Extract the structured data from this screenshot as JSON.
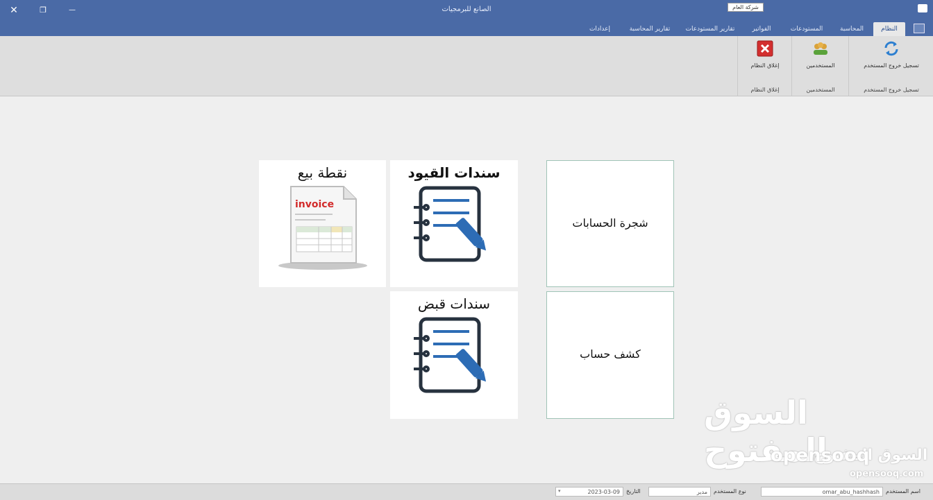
{
  "window": {
    "title": "الصانع للبرمجيات",
    "company": "شركة العام",
    "close_glyph": "✕",
    "restore_glyph": "❐",
    "minimize_glyph": "—"
  },
  "tabs": [
    {
      "label": "النظام",
      "active": true
    },
    {
      "label": "المحاسبة"
    },
    {
      "label": "المستودعات"
    },
    {
      "label": "الفواتير"
    },
    {
      "label": "تقارير المستودعات"
    },
    {
      "label": "تقارير المحاسبة"
    },
    {
      "label": "إعدادات"
    }
  ],
  "ribbon": {
    "logout": {
      "label": "تسجيل خروج المستخدم",
      "group": "تسجيل خروج المستخدم",
      "icon": "refresh-icon"
    },
    "users": {
      "label": "المستخدمين",
      "group": "المستخدمين",
      "icon": "users-icon"
    },
    "close_system": {
      "label": "إغلاق النظام",
      "group": "إغلاق النظام",
      "icon": "close-red-icon"
    }
  },
  "tiles": {
    "chart_of_accounts": "شجرة الحسابات",
    "account_statement": "كشف حساب",
    "journal_vouchers": "سندات القيود",
    "receipt_vouchers": "سندات قبض",
    "point_of_sale": "نقطة بيع",
    "invoice_word": "invoice"
  },
  "watermark": {
    "large": "السوق المفتوح",
    "small": "السوق المفتوح",
    "latin": "opensooq",
    "domain": "opensooq.com"
  },
  "status": {
    "username_label": "اسم المستخدم",
    "username_value": "omar_abu_hashhash",
    "usertype_label": "نوع المستخدم",
    "usertype_value": "مدير",
    "date_label": "التاريخ",
    "date_value": "2023-03-09"
  },
  "colors": {
    "titlebar": "#4a6aa6",
    "accent_icon": "#2d6cb5",
    "tile_border": "#9fc3b6"
  }
}
